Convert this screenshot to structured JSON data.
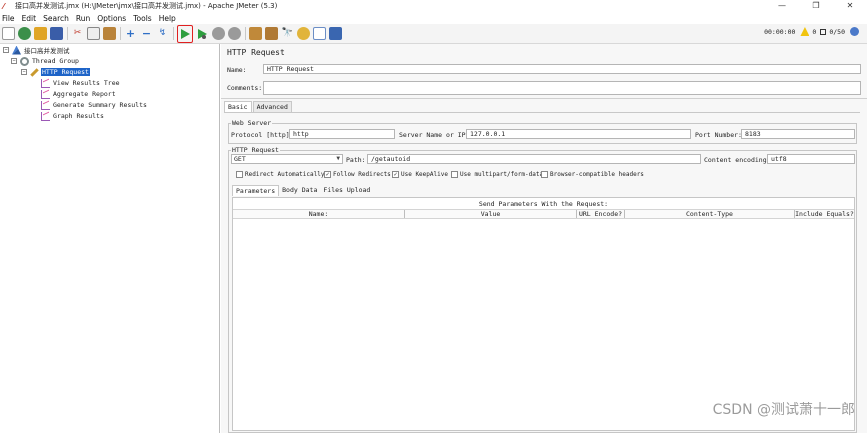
{
  "window": {
    "title": "接口高并发测试.jmx (H:\\JMeter\\jmx\\接口高并发测试.jmx) - Apache JMeter (5.3)",
    "controls": [
      "—",
      "❐",
      "✕"
    ]
  },
  "menu": [
    "File",
    "Edit",
    "Search",
    "Run",
    "Options",
    "Tools",
    "Help"
  ],
  "toolbar": {
    "elapsed": "00:00:00",
    "warnings": "0",
    "threads": "0/50"
  },
  "tree": {
    "test_plan": "接口高并发测试",
    "thread_group": "Thread Group",
    "http_request": "HTTP Request",
    "listeners": [
      "View Results Tree",
      "Aggregate Report",
      "Generate Summary Results",
      "Graph Results"
    ]
  },
  "panel": {
    "title": "HTTP Request",
    "name_label": "Name:",
    "name_value": "HTTP Request",
    "comments_label": "Comments:",
    "comments_value": "",
    "tabs": [
      "Basic",
      "Advanced"
    ],
    "web_server": {
      "title": "Web Server",
      "protocol_label": "Protocol [http]:",
      "protocol_value": "http",
      "server_label": "Server Name or IP:",
      "server_value": "127.0.0.1",
      "port_label": "Port Number:",
      "port_value": "8183"
    },
    "http_request": {
      "title": "HTTP Request",
      "method": "GET",
      "path_label": "Path:",
      "path_value": "/getautoid",
      "encoding_label": "Content encoding:",
      "encoding_value": "utf8"
    },
    "checkboxes": [
      {
        "label": "Redirect Automatically",
        "checked": false
      },
      {
        "label": "Follow Redirects",
        "checked": true
      },
      {
        "label": "Use KeepAlive",
        "checked": true
      },
      {
        "label": "Use multipart/form-data",
        "checked": false
      },
      {
        "label": "Browser-compatible headers",
        "checked": false
      }
    ],
    "param_tabs": [
      "Parameters",
      "Body Data",
      "Files Upload"
    ],
    "params_table": {
      "caption": "Send Parameters With the Request:",
      "columns": [
        "Name:",
        "Value",
        "URL Encode?",
        "Content-Type",
        "Include Equals?"
      ]
    }
  },
  "watermark": "CSDN @测试萧十一郎"
}
